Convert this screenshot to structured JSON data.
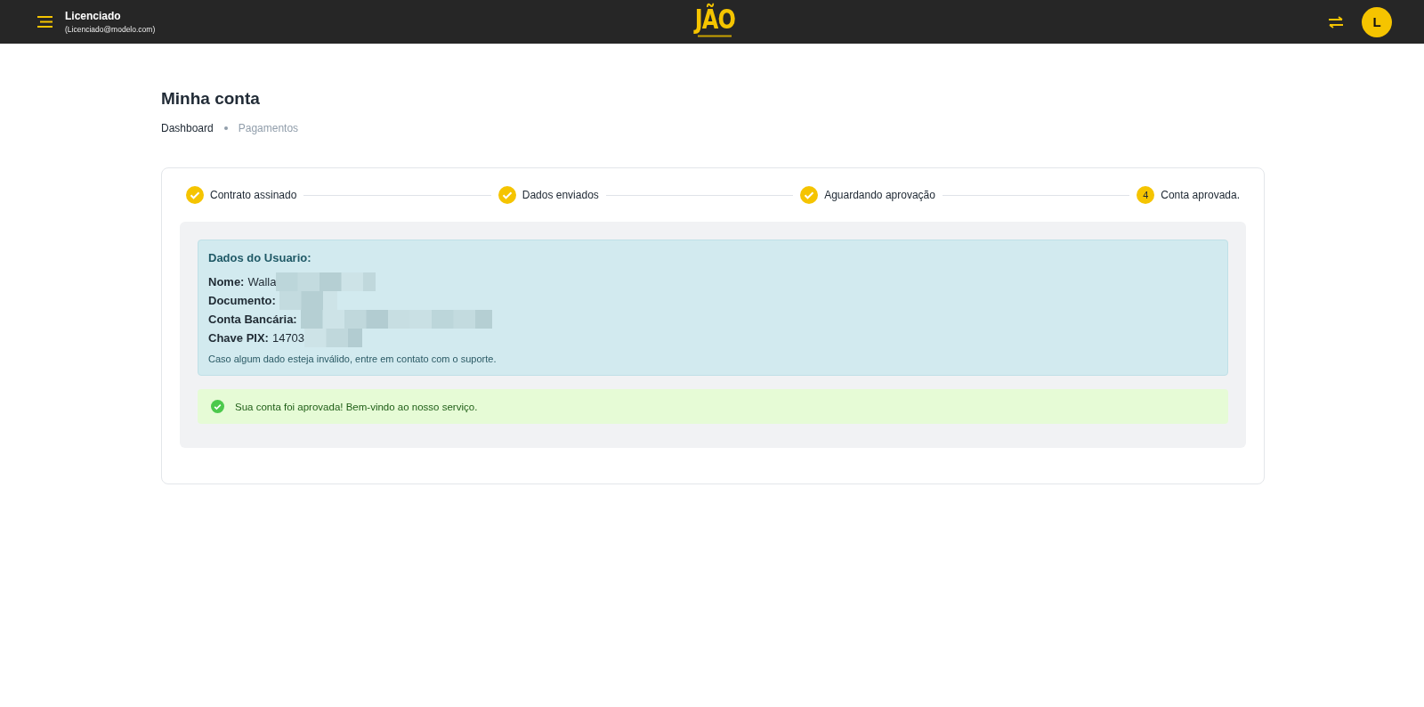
{
  "header": {
    "user_name": "Licenciado",
    "user_email": "(Licenciado@modelo.com)",
    "logo": "JÃO",
    "avatar_initial": "L"
  },
  "page": {
    "title": "Minha conta",
    "breadcrumbs": [
      {
        "label": "Dashboard",
        "current": false
      },
      {
        "label": "Pagamentos",
        "current": true
      }
    ]
  },
  "steps": [
    {
      "label": "Contrato assinado",
      "completed": true
    },
    {
      "label": "Dados enviados",
      "completed": true
    },
    {
      "label": "Aguardando aprovação",
      "completed": true
    },
    {
      "label": "Conta aprovada.",
      "completed": false,
      "number": "4"
    }
  ],
  "user_data": {
    "title": "Dados do Usuario:",
    "fields": [
      {
        "label": "Nome:",
        "value": "Walla",
        "redacted": true
      },
      {
        "label": "Documento:",
        "redacted": true
      },
      {
        "label": "Conta Bancária:",
        "redacted": true
      },
      {
        "label": "Chave PIX:",
        "value": "14703",
        "redacted": true
      }
    ],
    "note": "Caso algum dado esteja inválido, entre em contato com o suporte."
  },
  "success_message": "Sua conta foi aprovada! Bem-vindo ao nosso serviço."
}
